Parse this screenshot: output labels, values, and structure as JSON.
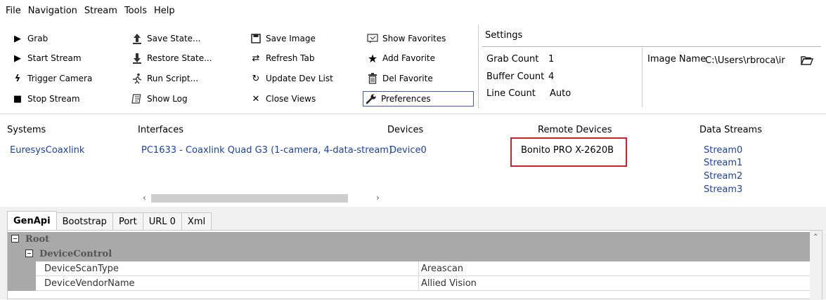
{
  "menu": [
    "File",
    "Navigation",
    "Stream",
    "Tools",
    "Help"
  ],
  "toolbar": {
    "col1": [
      {
        "label": "Grab",
        "icon": "grab-icon",
        "glyph": "▶"
      },
      {
        "label": "Start Stream",
        "icon": "play-icon",
        "glyph": "▶"
      },
      {
        "label": "Trigger Camera",
        "icon": "lightning-icon",
        "glyph": "ϟ"
      },
      {
        "label": "Stop Stream",
        "icon": "stop-icon",
        "glyph": "■"
      }
    ],
    "col2": [
      {
        "label": "Save State...",
        "icon": "upload-icon",
        "glyph": "⬆"
      },
      {
        "label": "Restore State...",
        "icon": "download-icon",
        "glyph": "⬇"
      },
      {
        "label": "Run Script...",
        "icon": "run-icon",
        "glyph": "☠"
      },
      {
        "label": "Show Log",
        "icon": "log-icon",
        "glyph": "☰"
      }
    ],
    "col3": [
      {
        "label": "Save Image",
        "icon": "save-icon",
        "glyph": "▣"
      },
      {
        "label": "Refresh Tab",
        "icon": "refresh-icon",
        "glyph": "↺"
      },
      {
        "label": "Update Dev List",
        "icon": "update-icon",
        "glyph": "↻"
      },
      {
        "label": "Close Views",
        "icon": "close-icon",
        "glyph": "✕"
      }
    ],
    "col4": [
      {
        "label": "Show Favorites",
        "icon": "favorites-icon",
        "glyph": "▭"
      },
      {
        "label": "Add Favorite",
        "icon": "star-icon",
        "glyph": "★"
      },
      {
        "label": "Del Favorite",
        "icon": "trash-icon",
        "glyph": "☒"
      },
      {
        "label": "Preferences",
        "icon": "wrench-icon",
        "glyph": "⚒"
      }
    ]
  },
  "settings": {
    "title": "Settings",
    "grab_count_label": "Grab Count",
    "grab_count_value": "1",
    "buffer_count_label": "Buffer Count",
    "buffer_count_value": "4",
    "line_count_label": "Line Count",
    "line_count_value": "Auto",
    "image_name_label": "Image Name",
    "image_name_value": "C:\\Users\\rbroca\\ir"
  },
  "columns": {
    "systems": "Systems",
    "interfaces": "Interfaces",
    "devices": "Devices",
    "remote_devices": "Remote Devices",
    "data_streams": "Data Streams"
  },
  "entries": {
    "system": "EuresysCoaxlink",
    "interface": "PC1633 - Coaxlink Quad G3 (1-camera, 4-data-stream)",
    "device": "Device0",
    "remote_device": "Bonito PRO X-2620B",
    "streams": [
      "Stream0",
      "Stream1",
      "Stream2",
      "Stream3"
    ]
  },
  "tabs": [
    "GenApi",
    "Bootstrap",
    "Port",
    "URL 0",
    "Xml"
  ],
  "tree": {
    "root": "Root",
    "group": "DeviceControl",
    "rows": [
      {
        "name": "DeviceScanType",
        "value": "Areascan"
      },
      {
        "name": "DeviceVendorName",
        "value": "Allied Vision"
      }
    ]
  },
  "colors": {
    "link": "#1a3fb0",
    "highlight": "#d0202a",
    "group_bg": "#a9a9a9"
  }
}
